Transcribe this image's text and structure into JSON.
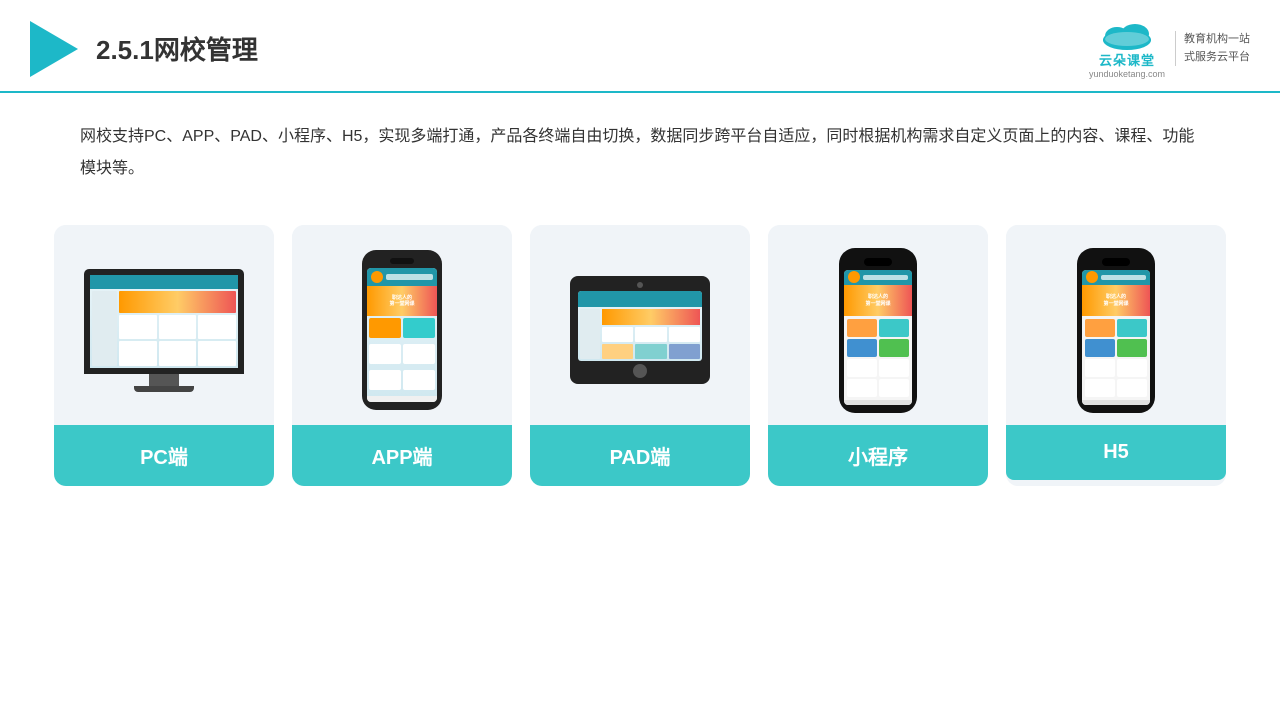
{
  "header": {
    "title": "2.5.1网校管理",
    "brand": {
      "name": "云朵课堂",
      "url": "yunduoketang.com",
      "slogan": "教育机构一站\n式服务云平台"
    }
  },
  "description": "网校支持PC、APP、PAD、小程序、H5，实现多端打通，产品各终端自由切换，数据同步跨平台自适应，同时根据机构需求自定义页面上的内容、课程、功能模块等。",
  "cards": [
    {
      "id": "pc",
      "label": "PC端"
    },
    {
      "id": "app",
      "label": "APP端"
    },
    {
      "id": "pad",
      "label": "PAD端"
    },
    {
      "id": "miniprogram",
      "label": "小程序"
    },
    {
      "id": "h5",
      "label": "H5"
    }
  ],
  "colors": {
    "accent": "#1db8c8",
    "card_bg": "#f0f4f8",
    "card_label": "#3cc8c8"
  }
}
